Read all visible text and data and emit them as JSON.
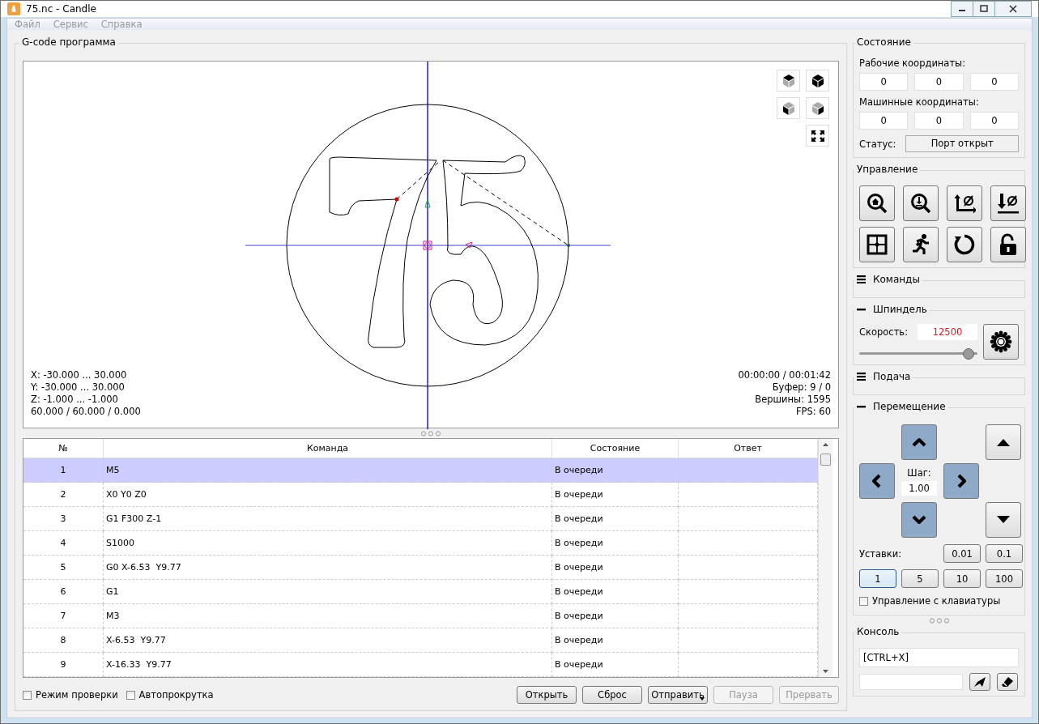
{
  "window": {
    "title": "75.nc - Candle"
  },
  "menu": [
    {
      "label": "Файл",
      "disabled": true
    },
    {
      "label": "Сервис",
      "disabled": true
    },
    {
      "label": "Справка",
      "disabled": true
    }
  ],
  "gcode_panel": {
    "title": "G-code программа",
    "viewer": {
      "info_left": [
        "X: -30.000 ... 30.000",
        "Y: -30.000 ... 30.000",
        "Z: -1.000 ... -1.000",
        "60.000 / 60.000 / 0.000"
      ],
      "info_right": [
        "00:00:00 / 00:01:42",
        "Буфер: 9 / 0",
        "Вершины: 1595",
        "FPS: 60"
      ]
    },
    "table": {
      "columns": [
        "№",
        "Команда",
        "Состояние",
        "Ответ"
      ],
      "rows": [
        {
          "cells": [
            "1",
            "M5",
            "В очереди",
            ""
          ],
          "selected": true
        },
        {
          "cells": [
            "2",
            "X0 Y0 Z0",
            "В очереди",
            ""
          ],
          "selected": false
        },
        {
          "cells": [
            "3",
            "G1 F300 Z-1",
            "В очереди",
            ""
          ],
          "selected": false
        },
        {
          "cells": [
            "4",
            "S1000",
            "В очереди",
            ""
          ],
          "selected": false
        },
        {
          "cells": [
            "5",
            "G0 X-6.53  Y9.77",
            "В очереди",
            ""
          ],
          "selected": false
        },
        {
          "cells": [
            "6",
            "G1",
            "В очереди",
            ""
          ],
          "selected": false
        },
        {
          "cells": [
            "7",
            "M3",
            "В очереди",
            ""
          ],
          "selected": false
        },
        {
          "cells": [
            "8",
            "X-6.53  Y9.77",
            "В очереди",
            ""
          ],
          "selected": false
        },
        {
          "cells": [
            "9",
            "X-16.33  Y9.77",
            "В очереди",
            ""
          ],
          "selected": false
        }
      ]
    },
    "options": [
      {
        "label": "Режим проверки",
        "checked": false
      },
      {
        "label": "Автопрокрутка",
        "checked": false
      }
    ],
    "buttons": [
      {
        "label": "Открыть",
        "disabled": false,
        "has_menu": false
      },
      {
        "label": "Сброс",
        "disabled": false,
        "has_menu": false
      },
      {
        "label": "Отправить",
        "disabled": false,
        "has_menu": true
      },
      {
        "label": "Пауза",
        "disabled": true,
        "has_menu": false
      },
      {
        "label": "Прервать",
        "disabled": true,
        "has_menu": false
      }
    ]
  },
  "state": {
    "title": "Состояние",
    "work_label": "Рабочие координаты:",
    "work_coords": [
      "0",
      "0",
      "0"
    ],
    "machine_label": "Машинные координаты:",
    "machine_coords": [
      "0",
      "0",
      "0"
    ],
    "status_label": "Статус:",
    "status_value": "Порт открыт"
  },
  "control": {
    "title": "Управление"
  },
  "commands": {
    "title": "Команды",
    "expanded": false
  },
  "spindle": {
    "title": "Шпиндель",
    "expanded": true,
    "speed_label": "Скорость:",
    "speed": "12500",
    "level": 0.97
  },
  "feed": {
    "title": "Подача",
    "expanded": false
  },
  "jog": {
    "title": "Перемещение",
    "expanded": true,
    "step_label": "Шаг:",
    "step": "1.00",
    "presets_label": "Уставки:",
    "presets": [
      {
        "label": "0.01",
        "selected": false
      },
      {
        "label": "0.1",
        "selected": false
      },
      {
        "label": "1",
        "selected": true
      },
      {
        "label": "5",
        "selected": false
      },
      {
        "label": "10",
        "selected": false
      },
      {
        "label": "100",
        "selected": false
      }
    ],
    "keyboard": {
      "label": "Управление с клавиатуры",
      "checked": false
    }
  },
  "console": {
    "title": "Консоль",
    "log": "[CTRL+X]"
  }
}
